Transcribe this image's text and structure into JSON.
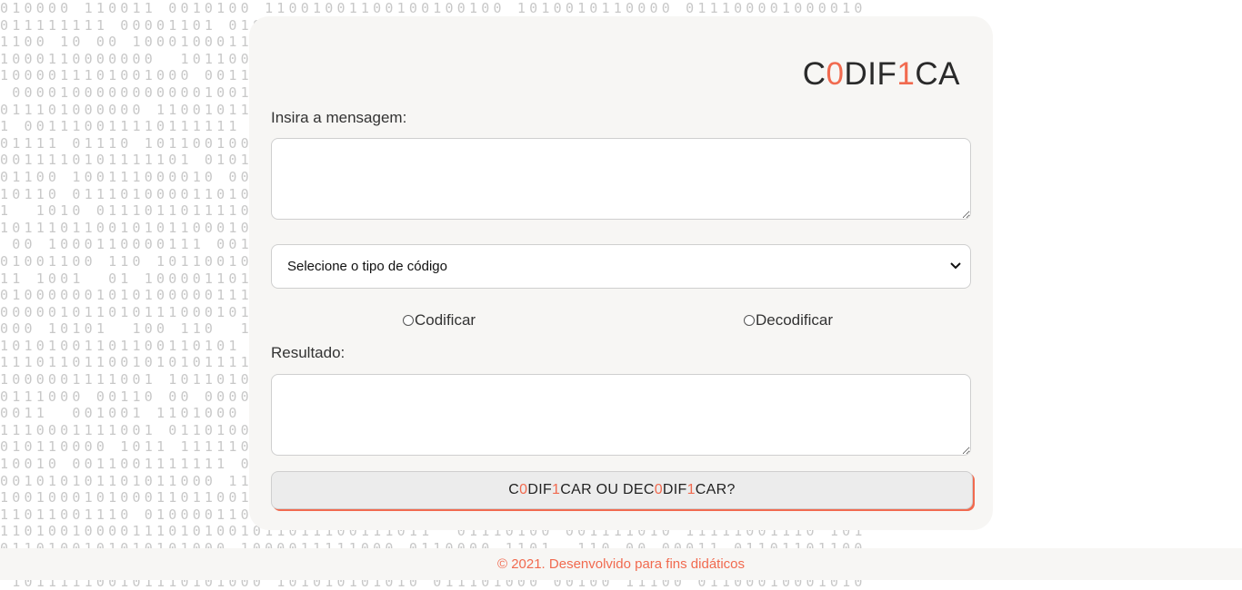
{
  "logo": {
    "part1": "C",
    "part2": "0",
    "part3": "DIF",
    "part4": "1",
    "part5": "CA"
  },
  "form": {
    "message_label": "Insira a mensagem:",
    "message_value": "",
    "code_select_value": "Selecione o tipo de código",
    "radio_encode_label": "Codificar",
    "radio_decode_label": "Decodificar",
    "result_label": "Resultado:",
    "result_value": ""
  },
  "button": {
    "p1": "C",
    "p2": "0",
    "p3": "DIF",
    "p4": "1",
    "p5": "CAR OU DEC",
    "p6": "0",
    "p7": "DIF",
    "p8": "1",
    "p9": "CAR?"
  },
  "footer": {
    "text": "© 2021. Desenvolvido para fins didáticos"
  },
  "colors": {
    "accent": "#f16a4f",
    "card_bg": "#f7f6f4",
    "binary_text": "#c8c8c8"
  },
  "icons": {
    "select_arrow": "chevron-down-icon"
  }
}
